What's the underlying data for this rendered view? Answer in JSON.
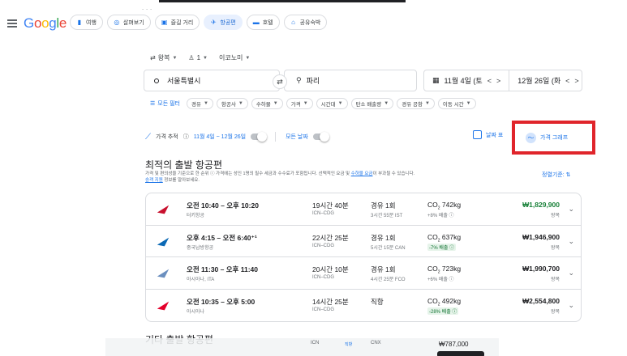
{
  "header": {
    "logo": [
      "G",
      "o",
      "o",
      "g",
      "l",
      "e"
    ],
    "logo_colors": [
      "#4285f4",
      "#ea4335",
      "#fbbc05",
      "#4285f4",
      "#34a853",
      "#ea4335"
    ],
    "chips": [
      {
        "label": "여행",
        "icon": "suitcase-icon"
      },
      {
        "label": "살펴보기",
        "icon": "explore-icon"
      },
      {
        "label": "즐길 거리",
        "icon": "camera-icon"
      },
      {
        "label": "항공편",
        "icon": "airplane-icon"
      },
      {
        "label": "호텔",
        "icon": "bed-icon"
      },
      {
        "label": "공유숙박",
        "icon": "house-icon"
      }
    ]
  },
  "search": {
    "trip_type": "왕복",
    "passengers": "1",
    "cabin": "이코노미",
    "origin": "서울특별시",
    "destination": "파리",
    "depart_date": "11월 4일 (토",
    "return_date": "12월 26일 (화"
  },
  "filters": {
    "all_label": "모든 필터",
    "chips": [
      "경유",
      "항공사",
      "수하물",
      "가격",
      "시간대",
      "탄소 배출량",
      "경유 공항",
      "이동 시간"
    ]
  },
  "tracking": {
    "label": "가격 추적",
    "range": "11월 4일 ~ 12월 26일",
    "all_dates": "모든 날짜",
    "date_grid": "날짜 표",
    "price_graph": "가격 그래프"
  },
  "best": {
    "title": "최적의 출발 항공편",
    "subtitle_a": "가격 및 편의성을 기준으로 한 순위 ⓘ  가격에는 성인 1명의 필수 세금과 수수료가 포함됩니다. 선택적인 요금 및 ",
    "subtitle_link": "수하물 요금",
    "subtitle_b": "이 부과될 수 있습니다.",
    "subtitle_link2": "승객 지원",
    "subtitle_c": " 정보를 알아보세요.",
    "sort_label": "정렬기준:"
  },
  "flights": [
    {
      "times": "오전 10:40 – 오후 10:20",
      "airline": "터키항공",
      "duration": "19시간 40분",
      "route": "ICN–CDG",
      "stops": "경유 1회",
      "layover": "3시간 55분 IST",
      "co2": "742kg",
      "emission": "+8% 배출 ⓘ",
      "emission_low": false,
      "price": "₩1,829,900",
      "price_green": true,
      "price_type": "왕복",
      "logo_color": "#c8102e"
    },
    {
      "times": "오후 4:15 – 오전 6:40⁺¹",
      "airline": "중국남방항공",
      "duration": "22시간 25분",
      "route": "ICN–CDG",
      "stops": "경유 1회",
      "layover": "5시간 15분 CAN",
      "co2": "637kg",
      "emission": "-7% 배출 ⓘ",
      "emission_low": true,
      "price": "₩1,946,900",
      "price_green": false,
      "price_type": "왕복",
      "logo_color": "#0b69b5"
    },
    {
      "times": "오전 11:30 – 오후 11:40",
      "airline": "아시아나, ITA",
      "duration": "20시간 10분",
      "route": "ICN–CDG",
      "stops": "경유 1회",
      "layover": "4시간 25분 FCO",
      "co2": "723kg",
      "emission": "+6% 배출 ⓘ",
      "emission_low": false,
      "price": "₩1,990,700",
      "price_green": false,
      "price_type": "왕복",
      "logo_color": "#6b8fbf"
    },
    {
      "times": "오전 10:35 – 오후 5:00",
      "airline": "아시아나",
      "duration": "14시간 25분",
      "route": "ICN–CDG",
      "stops": "직항",
      "layover": "",
      "co2": "492kg",
      "emission": "-28% 배출 ⓘ",
      "emission_low": true,
      "price": "₩2,554,800",
      "price_green": false,
      "price_type": "왕복",
      "logo_color": "#e4002b"
    }
  ],
  "other": {
    "title": "기타 출발 항공편",
    "overlay_a": "ICN",
    "overlay_b": "직항",
    "overlay_c": "CNX",
    "overlay_price": "₩787,000"
  }
}
